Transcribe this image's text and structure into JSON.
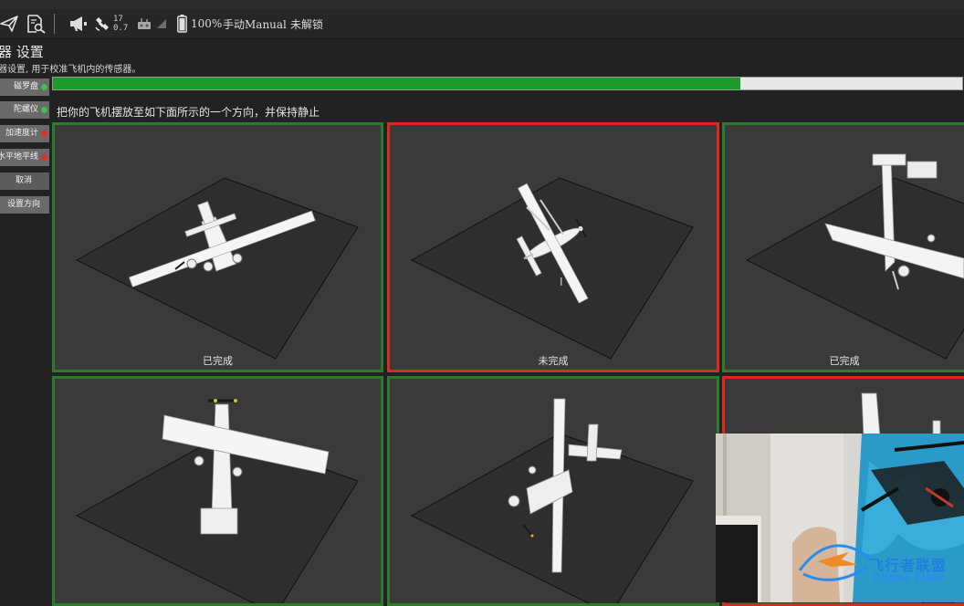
{
  "toolbar": {
    "satellite_count": "17",
    "hdop": "0.7",
    "battery": "100%",
    "flight_mode": "手动Manual",
    "arm_state": "未解锁"
  },
  "header": {
    "title": "器 设置",
    "subtitle": "器设置, 用于校准飞机内的传感器。"
  },
  "progress": {
    "fraction": 0.756
  },
  "sidebar": {
    "items": [
      {
        "label": "磁罗盘",
        "status_color": "#3ec24a"
      },
      {
        "label": "陀螺仪",
        "status_color": "#3ec24a"
      },
      {
        "label": "加速度计",
        "status_color": "#e0302a"
      },
      {
        "label": "水平地平线",
        "status_color": "#e0302a"
      },
      {
        "label": "取消"
      },
      {
        "label": "设置方向"
      }
    ]
  },
  "instruction": "把你的飞机摆放至如下面所示的一个方向，并保持静止",
  "orientations": [
    {
      "status": "已完成",
      "state": "completed"
    },
    {
      "status": "未完成",
      "state": "incomplete"
    },
    {
      "status": "已完成",
      "state": "completed"
    },
    {
      "status": "",
      "state": "completed"
    },
    {
      "status": "",
      "state": "completed"
    },
    {
      "status": "",
      "state": "incomplete"
    }
  ],
  "colors": {
    "completed_border": "#2c7a2c",
    "incomplete_border": "#d82a1e",
    "progress_fill": "#1e9a2c"
  },
  "watermark": {
    "cn": "飞行者联盟",
    "en": "China Flier"
  }
}
